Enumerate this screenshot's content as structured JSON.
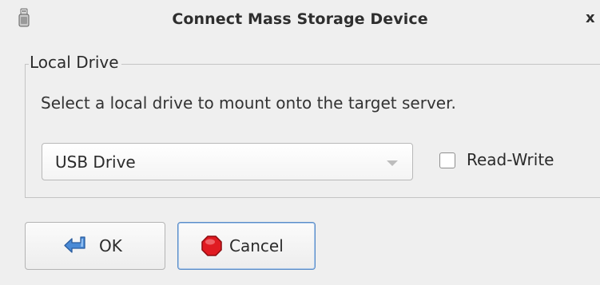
{
  "window": {
    "title": "Connect Mass Storage Device",
    "close_symbol": "x",
    "title_icon": "usb-drive-icon"
  },
  "group": {
    "legend": "Local Drive",
    "instruction": "Select a local drive to mount onto the target server."
  },
  "drive_select": {
    "value": "USB Drive",
    "arrow_icon": "chevron-down-icon"
  },
  "read_write": {
    "label": "Read-Write",
    "checked": false
  },
  "buttons": {
    "ok_label": "OK",
    "ok_icon": "enter-arrow-icon",
    "cancel_label": "Cancel",
    "cancel_icon": "stop-icon"
  },
  "colors": {
    "background": "#efefef",
    "focus_border": "#5a8cc7",
    "ok_icon_blue": "#3f7fc8",
    "cancel_icon_red": "#d7141a"
  }
}
